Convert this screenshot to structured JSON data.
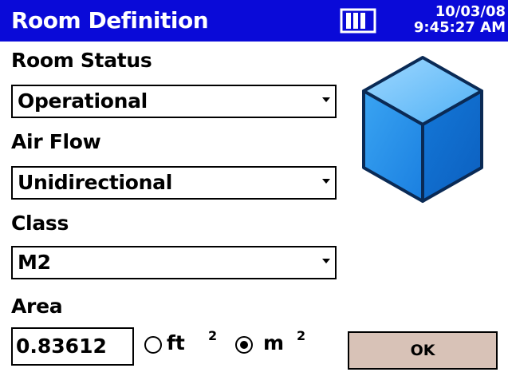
{
  "titlebar": {
    "title": "Room Definition",
    "battery_icon": "battery-icon",
    "date": "10/03/08",
    "time": "9:45:27 AM",
    "background_color": "#0a0ad8"
  },
  "room_status": {
    "label": "Room Status",
    "selected": "Operational"
  },
  "air_flow": {
    "label": "Air Flow",
    "selected": "Unidirectional"
  },
  "class": {
    "label": "Class",
    "selected": "M2"
  },
  "area": {
    "label": "Area",
    "value": "0.83612",
    "units": [
      {
        "label": "ft",
        "exponent": "2",
        "selected": false
      },
      {
        "label": "m",
        "exponent": "2",
        "selected": true
      }
    ]
  },
  "cube_icon": "cube-icon",
  "ok_button": {
    "label": "OK",
    "color": "#d8c2b7"
  }
}
